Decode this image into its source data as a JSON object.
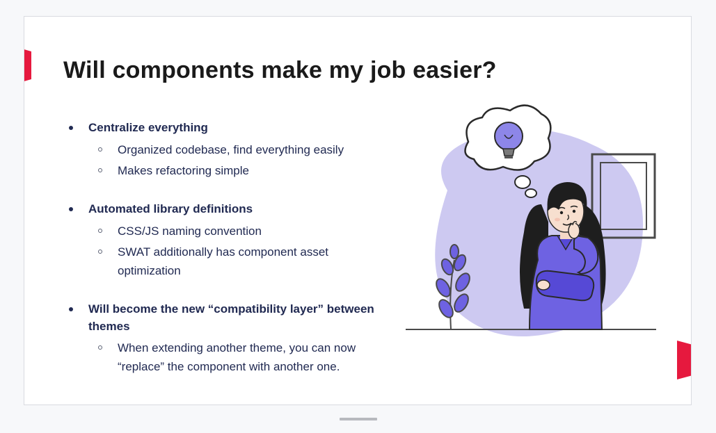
{
  "slide": {
    "title": "Will components make my job easier?",
    "bullets": [
      {
        "label": "Centralize everything",
        "sub": [
          "Organized codebase, find everything easily",
          "Makes refactoring simple"
        ]
      },
      {
        "label": "Automated library definitions",
        "sub": [
          "CSS/JS naming convention",
          "SWAT additionally has component asset optimization"
        ]
      },
      {
        "label": "Will become the new “compatibility layer” between themes",
        "sub": [
          "When extending another theme, you can now “replace” the component with another one."
        ]
      }
    ],
    "illustration_alt": "woman-thinking-lightbulb-illustration"
  },
  "colors": {
    "accent": "#e6193e",
    "text": "#212a52",
    "illus_purple": "#6e62e2",
    "illus_purple_light": "#cdc9f1"
  }
}
